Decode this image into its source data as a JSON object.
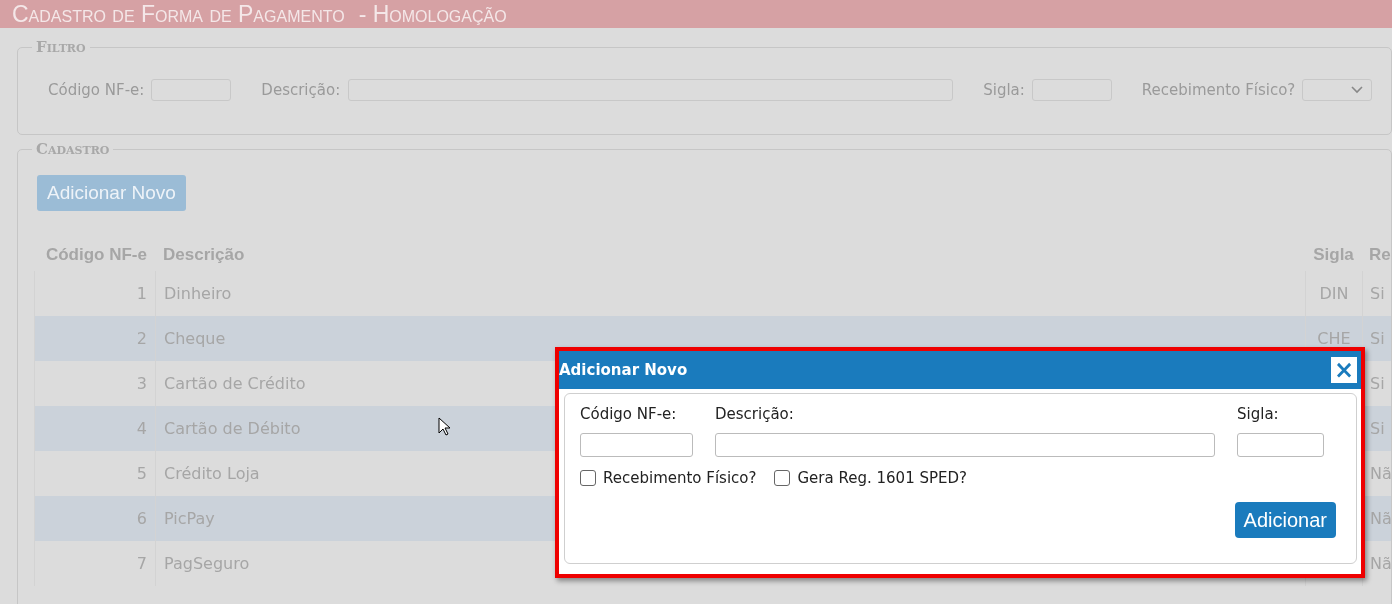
{
  "page": {
    "title": "Cadastro de Forma de Pagamento",
    "environment": "- Homologação"
  },
  "filter": {
    "legend": "Filtro",
    "fields": [
      {
        "kind": "text",
        "label": "Código NF-e:"
      },
      {
        "kind": "text",
        "label": "Descrição:"
      },
      {
        "kind": "text",
        "label": "Sigla:"
      },
      {
        "kind": "select",
        "label": "Recebimento Físico?"
      }
    ]
  },
  "register": {
    "legend": "Cadastro",
    "add_button": "Adicionar Novo",
    "table": {
      "columns": [
        "Código NF-e",
        "Descrição",
        "Sigla",
        "Re"
      ],
      "rows": [
        {
          "code": "1",
          "description": "Dinheiro",
          "sigla": "DIN",
          "column_4": "Si"
        },
        {
          "code": "2",
          "description": "Cheque",
          "sigla": "CHE",
          "column_4": "Si"
        },
        {
          "code": "3",
          "description": "Cartão de Crédito",
          "column_4": "Si"
        },
        {
          "code": "4",
          "description": "Cartão de Débito",
          "column_4": "Si"
        },
        {
          "code": "5",
          "description": "Crédito Loja",
          "column_4": "Nã"
        },
        {
          "code": "6",
          "description": "PicPay",
          "column_4": "Nã"
        },
        {
          "code": "7",
          "description": "PagSeguro",
          "column_4": "Nã"
        }
      ]
    }
  },
  "dialog": {
    "title": "Adicionar Novo",
    "close": "×",
    "fields": [
      {
        "label": "Código NF-e:"
      },
      {
        "label": "Descrição:"
      },
      {
        "label": "Sigla:"
      }
    ],
    "checkboxes": [
      {
        "label": "Recebimento Físico?",
        "checked": false
      },
      {
        "label": "Gera Reg. 1601 SPED?",
        "checked": false
      }
    ],
    "submit": "Adicionar"
  }
}
